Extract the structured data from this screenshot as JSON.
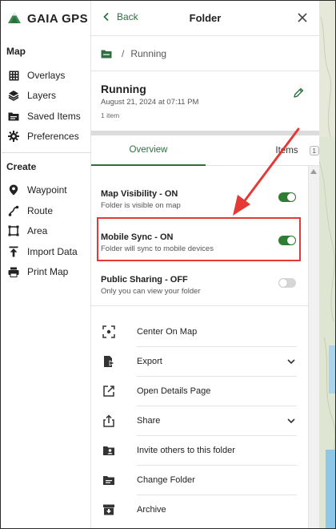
{
  "brand": {
    "name": "GAIA GPS",
    "color": "#2e6f40"
  },
  "sidebar": {
    "map_heading": "Map",
    "map_items": [
      {
        "label": "Overlays",
        "icon": "overlays-icon"
      },
      {
        "label": "Layers",
        "icon": "layers-icon"
      },
      {
        "label": "Saved Items",
        "icon": "saved-items-icon"
      },
      {
        "label": "Preferences",
        "icon": "gear-icon"
      }
    ],
    "create_heading": "Create",
    "create_items": [
      {
        "label": "Waypoint",
        "icon": "waypoint-pin-icon"
      },
      {
        "label": "Route",
        "icon": "route-icon"
      },
      {
        "label": "Area",
        "icon": "area-icon"
      },
      {
        "label": "Import Data",
        "icon": "upload-icon"
      },
      {
        "label": "Print Map",
        "icon": "printer-icon"
      }
    ]
  },
  "panel": {
    "back_label": "Back",
    "title": "Folder",
    "breadcrumb": {
      "separator": "/",
      "current": "Running"
    },
    "folder": {
      "name": "Running",
      "date": "August 21, 2024 at 07:11 PM",
      "count": "1 item"
    },
    "tabs": [
      {
        "label": "Overview",
        "active": true
      },
      {
        "label": "Items",
        "badge": "1",
        "active": false
      }
    ],
    "settings": [
      {
        "title": "Map Visibility - ON",
        "subtitle": "Folder is visible on map",
        "on": true
      },
      {
        "title": "Mobile Sync - ON",
        "subtitle": "Folder will sync to mobile devices",
        "on": true,
        "highlighted": true
      },
      {
        "title": "Public Sharing - OFF",
        "subtitle": "Only you can view your folder",
        "on": false
      }
    ],
    "actions": [
      {
        "label": "Center On Map",
        "icon": "center-focus-icon",
        "has_chevron": false
      },
      {
        "label": "Export",
        "icon": "export-icon",
        "has_chevron": true
      },
      {
        "label": "Open Details Page",
        "icon": "open-external-icon",
        "has_chevron": false
      },
      {
        "label": "Share",
        "icon": "share-icon",
        "has_chevron": true
      },
      {
        "label": "Invite others to this folder",
        "icon": "invite-folder-icon",
        "has_chevron": false
      },
      {
        "label": "Change Folder",
        "icon": "folder-icon",
        "has_chevron": false
      },
      {
        "label": "Archive",
        "icon": "archive-icon",
        "has_chevron": false
      }
    ]
  },
  "colors": {
    "accent": "#2e6f40",
    "toggle_on": "#2e7d32",
    "annotation": "#e53935"
  }
}
